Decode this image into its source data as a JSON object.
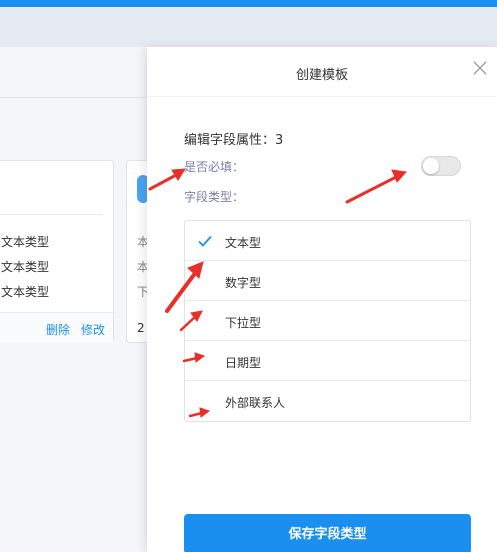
{
  "background": {
    "card1": {
      "rows": [
        "文本类型",
        "文本类型",
        "文本类型"
      ],
      "delete_label": "删除",
      "edit_label": "修改"
    },
    "card2": {
      "rows": [
        "本",
        "本",
        "下",
        "2"
      ]
    }
  },
  "panel": {
    "title": "创建模板",
    "attr_label": "编辑字段属性：3",
    "required_label": "是否必填：",
    "required_enabled": false,
    "type_label": "字段类型：",
    "types": [
      {
        "label": "文本型",
        "selected": true
      },
      {
        "label": "数字型",
        "selected": false
      },
      {
        "label": "下拉型",
        "selected": false
      },
      {
        "label": "日期型",
        "selected": false
      },
      {
        "label": "外部联系人",
        "selected": false
      }
    ],
    "save_label": "保存字段类型"
  },
  "colors": {
    "accent": "#1a8ff0",
    "annotation_arrow": "#e8302a",
    "muted_label": "#7a7fa8"
  },
  "icons": {
    "close": "close-icon",
    "check": "check-icon"
  }
}
